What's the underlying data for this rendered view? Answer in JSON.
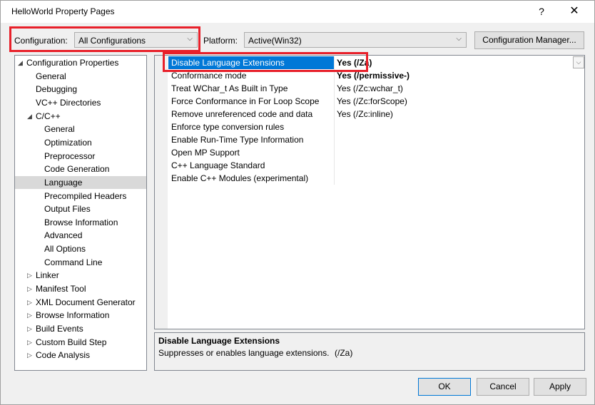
{
  "window": {
    "title": "HelloWorld Property Pages",
    "help_glyph": "?",
    "close_glyph": "✕"
  },
  "toolbar": {
    "configuration_label": "Configuration:",
    "configuration_value": "All Configurations",
    "platform_label": "Platform:",
    "platform_value": "Active(Win32)",
    "config_manager_label": "Configuration Manager..."
  },
  "tree": {
    "items": [
      {
        "label": "Configuration Properties",
        "level": 0,
        "expander": "◢"
      },
      {
        "label": "General",
        "level": 1
      },
      {
        "label": "Debugging",
        "level": 1
      },
      {
        "label": "VC++ Directories",
        "level": 1
      },
      {
        "label": "C/C++",
        "level": 1,
        "expander": "◢"
      },
      {
        "label": "General",
        "level": 2
      },
      {
        "label": "Optimization",
        "level": 2
      },
      {
        "label": "Preprocessor",
        "level": 2
      },
      {
        "label": "Code Generation",
        "level": 2
      },
      {
        "label": "Language",
        "level": 2,
        "selected": true
      },
      {
        "label": "Precompiled Headers",
        "level": 2
      },
      {
        "label": "Output Files",
        "level": 2
      },
      {
        "label": "Browse Information",
        "level": 2
      },
      {
        "label": "Advanced",
        "level": 2
      },
      {
        "label": "All Options",
        "level": 2
      },
      {
        "label": "Command Line",
        "level": 2
      },
      {
        "label": "Linker",
        "level": 1,
        "expander": "▷"
      },
      {
        "label": "Manifest Tool",
        "level": 1,
        "expander": "▷"
      },
      {
        "label": "XML Document Generator",
        "level": 1,
        "expander": "▷"
      },
      {
        "label": "Browse Information",
        "level": 1,
        "expander": "▷"
      },
      {
        "label": "Build Events",
        "level": 1,
        "expander": "▷"
      },
      {
        "label": "Custom Build Step",
        "level": 1,
        "expander": "▷"
      },
      {
        "label": "Code Analysis",
        "level": 1,
        "expander": "▷"
      }
    ]
  },
  "grid": {
    "dropdown_glyph": "⌵",
    "rows": [
      {
        "name": "Disable Language Extensions",
        "value": "Yes (/Za)",
        "selected": true,
        "bold": true
      },
      {
        "name": "Conformance mode",
        "value": "Yes (/permissive-)",
        "bold": true
      },
      {
        "name": "Treat WChar_t As Built in Type",
        "value": "Yes (/Zc:wchar_t)"
      },
      {
        "name": "Force Conformance in For Loop Scope",
        "value": "Yes (/Zc:forScope)"
      },
      {
        "name": "Remove unreferenced code and data",
        "value": "Yes (/Zc:inline)"
      },
      {
        "name": "Enforce type conversion rules",
        "value": ""
      },
      {
        "name": "Enable Run-Time Type Information",
        "value": ""
      },
      {
        "name": "Open MP Support",
        "value": ""
      },
      {
        "name": "C++ Language Standard",
        "value": ""
      },
      {
        "name": "Enable C++ Modules (experimental)",
        "value": ""
      }
    ]
  },
  "description": {
    "title": "Disable Language Extensions",
    "text": "Suppresses or enables language extensions.",
    "flag": "(/Za)"
  },
  "buttons": {
    "ok": "OK",
    "cancel": "Cancel",
    "apply": "Apply"
  },
  "colors": {
    "selection": "#0078d7",
    "highlight_box": "#e8202a",
    "tree_selection": "#d9d9d9"
  }
}
